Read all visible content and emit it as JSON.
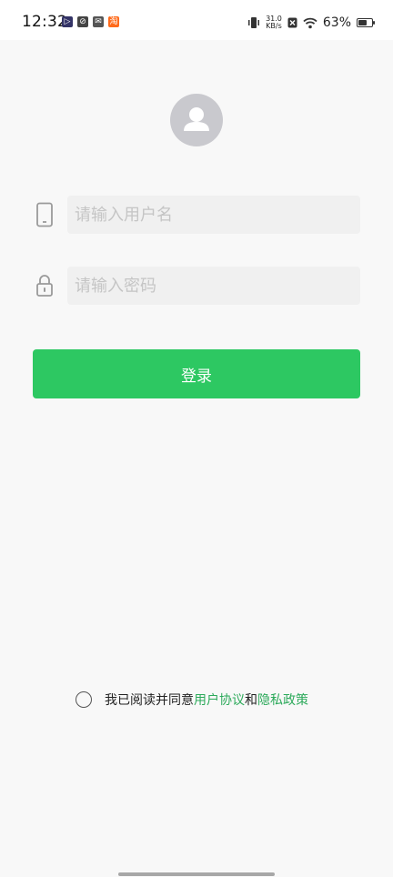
{
  "status_bar": {
    "time": "12:32",
    "net_speed_value": "31.0",
    "net_speed_unit": "KB/s",
    "battery_percent": "63%",
    "battery_level": 0.63,
    "notifications": [
      {
        "icon": "media-play-icon",
        "color": "#333366",
        "glyph": "▷"
      },
      {
        "icon": "sync-app-icon",
        "color": "#444444",
        "glyph": "⊘"
      },
      {
        "icon": "mail-icon",
        "color": "#555555",
        "glyph": "✉"
      },
      {
        "icon": "taobao-app-icon",
        "color": "#ff6a1a",
        "glyph": "淘"
      }
    ]
  },
  "login": {
    "username_placeholder": "请输入用户名",
    "password_placeholder": "请输入密码",
    "submit_label": "登录"
  },
  "agreement": {
    "prefix": "我已阅读并同意",
    "user_agreement": "用户协议",
    "conjunction": "和",
    "privacy_policy": "隐私政策",
    "accent_color": "#2daa5b"
  },
  "colors": {
    "primary_button": "#2dc862",
    "background": "#f8f8f8",
    "input_background": "#f0f0f0"
  }
}
